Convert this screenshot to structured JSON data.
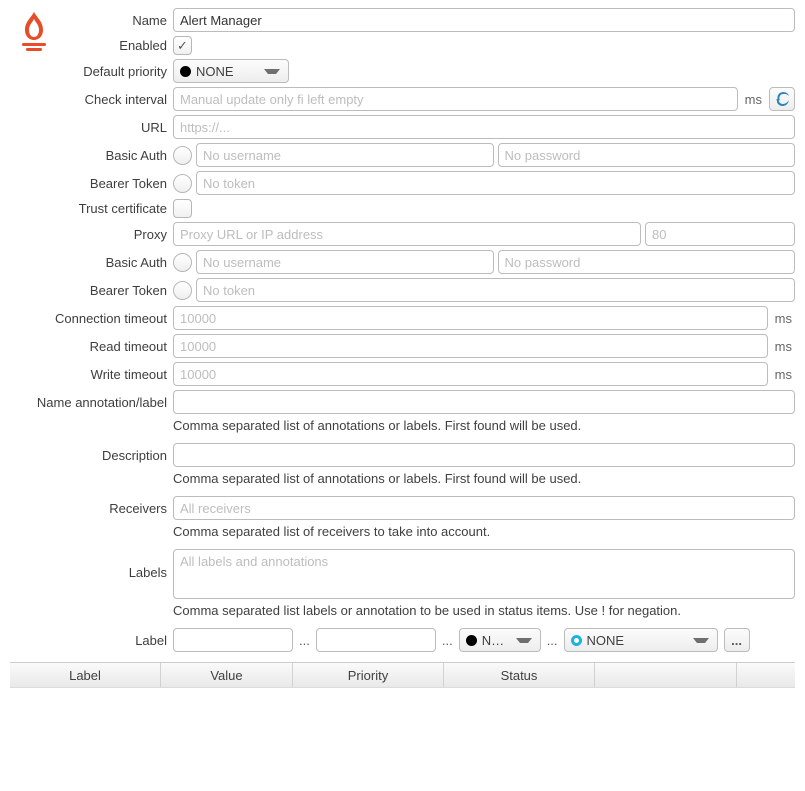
{
  "form": {
    "name": {
      "label": "Name",
      "value": "Alert Manager"
    },
    "enabled": {
      "label": "Enabled",
      "checked": true
    },
    "priority": {
      "label": "Default priority",
      "value": "NONE"
    },
    "check_interval": {
      "label": "Check interval",
      "placeholder": "Manual update only fi left empty",
      "suffix": "ms"
    },
    "url": {
      "label": "URL",
      "placeholder": "https://..."
    },
    "basic_auth": {
      "label": "Basic Auth",
      "user_placeholder": "No username",
      "pass_placeholder": "No password"
    },
    "bearer": {
      "label": "Bearer Token",
      "placeholder": "No token"
    },
    "trust_cert": {
      "label": "Trust certificate"
    },
    "proxy": {
      "label": "Proxy",
      "placeholder": "Proxy URL or IP address",
      "port_placeholder": "80"
    },
    "proxy_basic_auth": {
      "label": "Basic Auth",
      "user_placeholder": "No username",
      "pass_placeholder": "No password"
    },
    "proxy_bearer": {
      "label": "Bearer Token",
      "placeholder": "No token"
    },
    "conn_timeout": {
      "label": "Connection timeout",
      "placeholder": "10000",
      "suffix": "ms"
    },
    "read_timeout": {
      "label": "Read timeout",
      "placeholder": "10000",
      "suffix": "ms"
    },
    "write_timeout": {
      "label": "Write timeout",
      "placeholder": "10000",
      "suffix": "ms"
    },
    "name_anno": {
      "label": "Name annotation/label",
      "help": "Comma separated list of annotations or labels. First found will be used."
    },
    "description": {
      "label": "Description",
      "help": "Comma separated list of annotations or labels. First found will be used."
    },
    "receivers": {
      "label": "Receivers",
      "placeholder": "All receivers",
      "help": "Comma separated list of receivers to take into account."
    },
    "labels": {
      "label": "Labels",
      "placeholder": "All labels and annotations",
      "help": "Comma separated list labels or annotation to be used in status items. Use ! for negation."
    },
    "label_filter": {
      "label": "Label",
      "sep": "...",
      "combo1_value": "N…",
      "combo2_value": "NONE",
      "more": "..."
    },
    "table": {
      "col_label": "Label",
      "col_value": "Value",
      "col_priority": "Priority",
      "col_status": "Status"
    }
  },
  "colors": {
    "brand": "#e64d28"
  }
}
